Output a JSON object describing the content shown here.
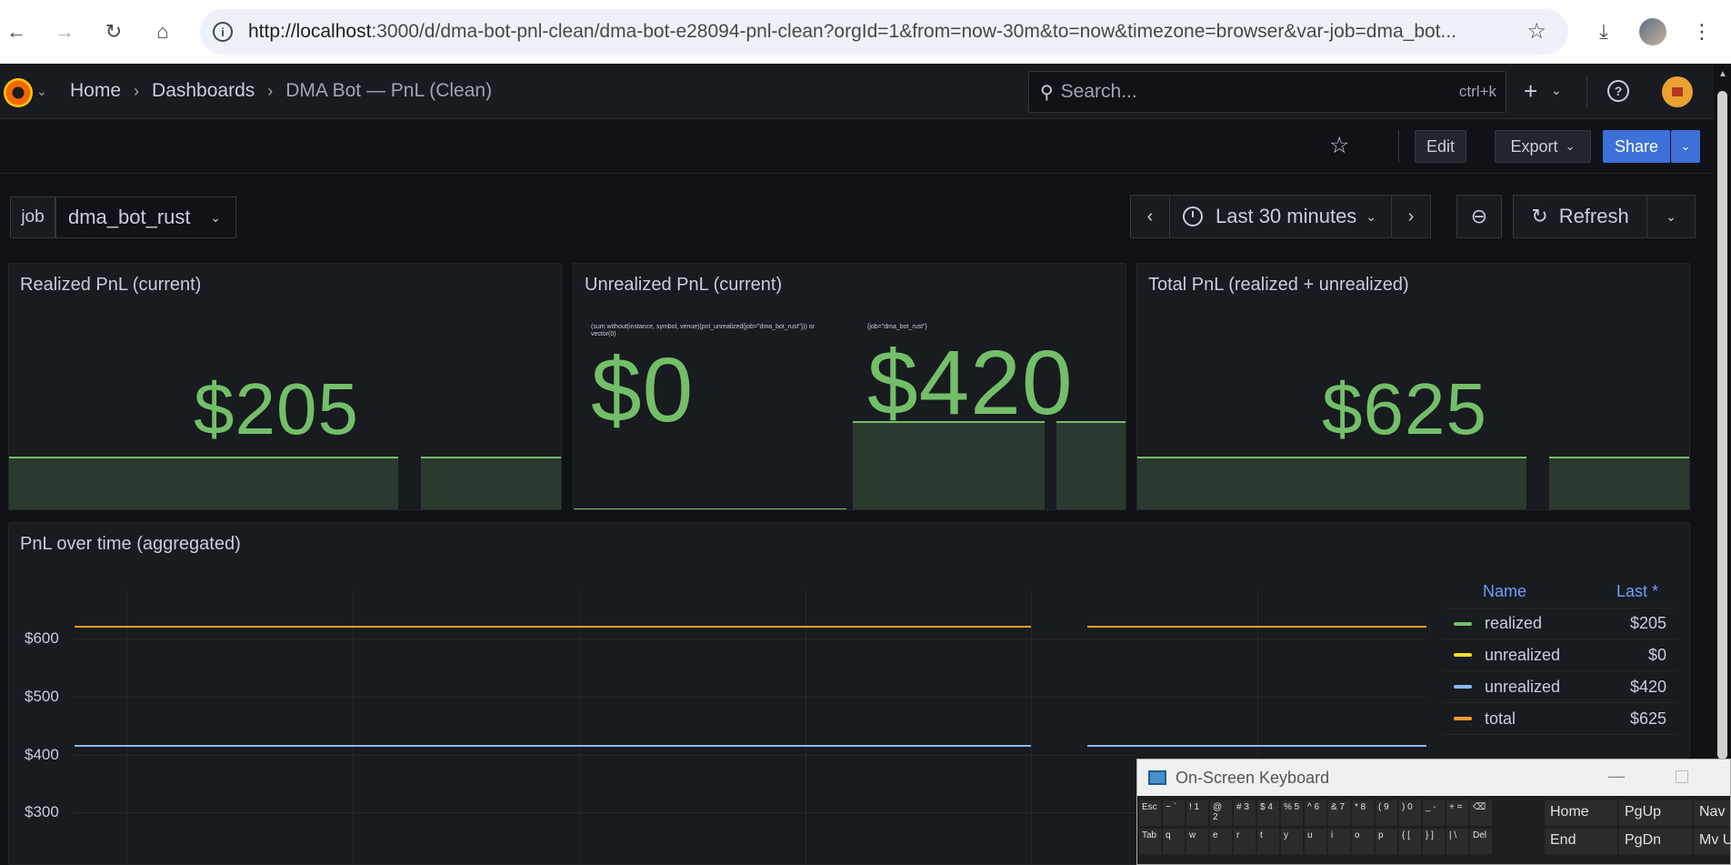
{
  "browser": {
    "url_host": "http://localhost",
    "url_rest": ":3000/d/dma-bot-pnl-clean/dma-bot-e28094-pnl-clean?orgId=1&from=now-30m&to=now&timezone=browser&var-job=dma_bot..."
  },
  "nav": {
    "breadcrumbs": [
      "Home",
      "Dashboards",
      "DMA Bot — PnL (Clean)"
    ],
    "search_placeholder": "Search...",
    "search_shortcut": "ctrl+k"
  },
  "toolbar": {
    "edit": "Edit",
    "export": "Export",
    "share": "Share"
  },
  "variables": {
    "job_label": "job",
    "job_value": "dma_bot_rust"
  },
  "timepicker": {
    "range": "Last 30 minutes",
    "refresh": "Refresh"
  },
  "panels": {
    "realized": {
      "title": "Realized PnL (current)",
      "value": "$205"
    },
    "unrealized": {
      "title": "Unrealized PnL (current)",
      "series_a_label": "(sum without(instance, symbol, venue)(pnl_unrealized{job=\"dma_bot_rust\"})) or vector(0)",
      "series_a_value": "$0",
      "series_b_label": "{job=\"dma_bot_rust\"}",
      "series_b_value": "$420"
    },
    "total": {
      "title": "Total PnL (realized + unrealized)",
      "value": "$625"
    },
    "timeseries": {
      "title": "PnL over time (aggregated)",
      "y_ticks": [
        "$600",
        "$500",
        "$400",
        "$300"
      ],
      "legend_name_header": "Name",
      "legend_last_header": "Last *",
      "legend": [
        {
          "name": "realized",
          "last": "$205",
          "color": "#73bf69"
        },
        {
          "name": "unrealized",
          "last": "$0",
          "color": "#fade2a"
        },
        {
          "name": "unrealized",
          "last": "$420",
          "color": "#8ab8ff"
        },
        {
          "name": "total",
          "last": "$625",
          "color": "#ff9830"
        }
      ]
    }
  },
  "osk": {
    "title": "On-Screen Keyboard",
    "row1": [
      "Esc",
      "~ `",
      "! 1",
      "@ 2",
      "# 3",
      "$ 4",
      "% 5",
      "^ 6",
      "& 7",
      "* 8",
      "( 9",
      ") 0",
      "_ -",
      "+ =",
      "⌫"
    ],
    "row1_nav": [
      "Home",
      "PgUp",
      "Nav"
    ],
    "row2": [
      "Tab",
      "q",
      "w",
      "e",
      "r",
      "t",
      "y",
      "u",
      "i",
      "o",
      "p",
      "{ [",
      "} ]",
      "| \\",
      "Del"
    ],
    "row2_nav": [
      "End",
      "PgDn",
      "Mv Up"
    ]
  }
}
